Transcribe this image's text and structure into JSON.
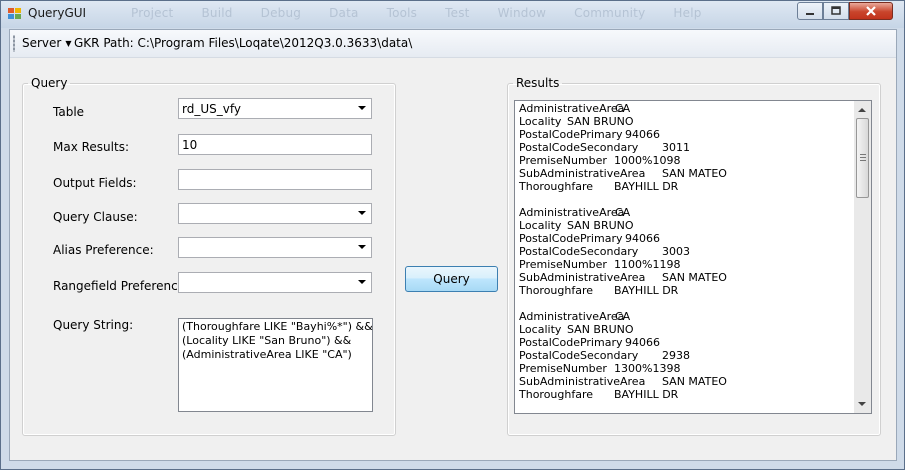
{
  "window": {
    "title": "QueryGUI"
  },
  "background_menu": [
    "Project",
    "Build",
    "Debug",
    "Data",
    "Tools",
    "Test",
    "Window",
    "Community",
    "Help"
  ],
  "toolbar": {
    "server_label": "Server",
    "gkr_path": "GKR Path: C:\\Program Files\\Loqate\\2012Q3.0.3633\\data\\"
  },
  "query": {
    "group_title": "Query",
    "table_label": "Table",
    "table_value": "rd_US_vfy",
    "max_results_label": "Max Results:",
    "max_results_value": "10",
    "output_fields_label": "Output Fields:",
    "output_fields_value": "",
    "query_clause_label": "Query Clause:",
    "alias_label": "Alias Preference:",
    "rangefield_label": "Rangefield Preference:",
    "query_string_label": "Query String:",
    "query_string_value": "(Thoroughfare LIKE \"Bayhi%*\") &&\n(Locality LIKE \"San Bruno\") &&\n(AdministrativeArea LIKE \"CA\")",
    "query_button": "Query"
  },
  "results": {
    "group_title": "Results",
    "records": [
      [
        {
          "k": "AdministrativeArea",
          "v": "CA"
        },
        {
          "k": "Locality",
          "v": "SAN BRUNO"
        },
        {
          "k": "PostalCodePrimary",
          "v": "94066"
        },
        {
          "k": "PostalCodeSecondary",
          "v": "3011"
        },
        {
          "k": "PremiseNumber",
          "v": "1000%1098"
        },
        {
          "k": "SubAdministrativeArea",
          "v": "SAN MATEO"
        },
        {
          "k": "Thoroughfare",
          "v": "BAYHILL DR"
        }
      ],
      [
        {
          "k": "AdministrativeArea",
          "v": "CA"
        },
        {
          "k": "Locality",
          "v": "SAN BRUNO"
        },
        {
          "k": "PostalCodePrimary",
          "v": "94066"
        },
        {
          "k": "PostalCodeSecondary",
          "v": "3003"
        },
        {
          "k": "PremiseNumber",
          "v": "1100%1198"
        },
        {
          "k": "SubAdministrativeArea",
          "v": "SAN MATEO"
        },
        {
          "k": "Thoroughfare",
          "v": "BAYHILL DR"
        }
      ],
      [
        {
          "k": "AdministrativeArea",
          "v": "CA"
        },
        {
          "k": "Locality",
          "v": "SAN BRUNO"
        },
        {
          "k": "PostalCodePrimary",
          "v": "94066"
        },
        {
          "k": "PostalCodeSecondary",
          "v": "2938"
        },
        {
          "k": "PremiseNumber",
          "v": "1300%1398"
        },
        {
          "k": "SubAdministrativeArea",
          "v": "SAN MATEO"
        },
        {
          "k": "Thoroughfare",
          "v": "BAYHILL DR"
        }
      ]
    ]
  }
}
